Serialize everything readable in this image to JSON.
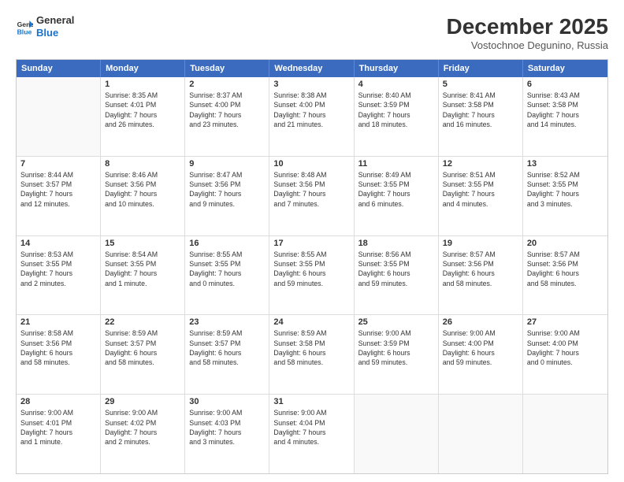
{
  "header": {
    "logo_line1": "General",
    "logo_line2": "Blue",
    "month_title": "December 2025",
    "location": "Vostochnoe Degunino, Russia"
  },
  "days_of_week": [
    "Sunday",
    "Monday",
    "Tuesday",
    "Wednesday",
    "Thursday",
    "Friday",
    "Saturday"
  ],
  "weeks": [
    [
      {
        "day": "",
        "info": ""
      },
      {
        "day": "1",
        "info": "Sunrise: 8:35 AM\nSunset: 4:01 PM\nDaylight: 7 hours\nand 26 minutes."
      },
      {
        "day": "2",
        "info": "Sunrise: 8:37 AM\nSunset: 4:00 PM\nDaylight: 7 hours\nand 23 minutes."
      },
      {
        "day": "3",
        "info": "Sunrise: 8:38 AM\nSunset: 4:00 PM\nDaylight: 7 hours\nand 21 minutes."
      },
      {
        "day": "4",
        "info": "Sunrise: 8:40 AM\nSunset: 3:59 PM\nDaylight: 7 hours\nand 18 minutes."
      },
      {
        "day": "5",
        "info": "Sunrise: 8:41 AM\nSunset: 3:58 PM\nDaylight: 7 hours\nand 16 minutes."
      },
      {
        "day": "6",
        "info": "Sunrise: 8:43 AM\nSunset: 3:58 PM\nDaylight: 7 hours\nand 14 minutes."
      }
    ],
    [
      {
        "day": "7",
        "info": "Sunrise: 8:44 AM\nSunset: 3:57 PM\nDaylight: 7 hours\nand 12 minutes."
      },
      {
        "day": "8",
        "info": "Sunrise: 8:46 AM\nSunset: 3:56 PM\nDaylight: 7 hours\nand 10 minutes."
      },
      {
        "day": "9",
        "info": "Sunrise: 8:47 AM\nSunset: 3:56 PM\nDaylight: 7 hours\nand 9 minutes."
      },
      {
        "day": "10",
        "info": "Sunrise: 8:48 AM\nSunset: 3:56 PM\nDaylight: 7 hours\nand 7 minutes."
      },
      {
        "day": "11",
        "info": "Sunrise: 8:49 AM\nSunset: 3:55 PM\nDaylight: 7 hours\nand 6 minutes."
      },
      {
        "day": "12",
        "info": "Sunrise: 8:51 AM\nSunset: 3:55 PM\nDaylight: 7 hours\nand 4 minutes."
      },
      {
        "day": "13",
        "info": "Sunrise: 8:52 AM\nSunset: 3:55 PM\nDaylight: 7 hours\nand 3 minutes."
      }
    ],
    [
      {
        "day": "14",
        "info": "Sunrise: 8:53 AM\nSunset: 3:55 PM\nDaylight: 7 hours\nand 2 minutes."
      },
      {
        "day": "15",
        "info": "Sunrise: 8:54 AM\nSunset: 3:55 PM\nDaylight: 7 hours\nand 1 minute."
      },
      {
        "day": "16",
        "info": "Sunrise: 8:55 AM\nSunset: 3:55 PM\nDaylight: 7 hours\nand 0 minutes."
      },
      {
        "day": "17",
        "info": "Sunrise: 8:55 AM\nSunset: 3:55 PM\nDaylight: 6 hours\nand 59 minutes."
      },
      {
        "day": "18",
        "info": "Sunrise: 8:56 AM\nSunset: 3:55 PM\nDaylight: 6 hours\nand 59 minutes."
      },
      {
        "day": "19",
        "info": "Sunrise: 8:57 AM\nSunset: 3:56 PM\nDaylight: 6 hours\nand 58 minutes."
      },
      {
        "day": "20",
        "info": "Sunrise: 8:57 AM\nSunset: 3:56 PM\nDaylight: 6 hours\nand 58 minutes."
      }
    ],
    [
      {
        "day": "21",
        "info": "Sunrise: 8:58 AM\nSunset: 3:56 PM\nDaylight: 6 hours\nand 58 minutes."
      },
      {
        "day": "22",
        "info": "Sunrise: 8:59 AM\nSunset: 3:57 PM\nDaylight: 6 hours\nand 58 minutes."
      },
      {
        "day": "23",
        "info": "Sunrise: 8:59 AM\nSunset: 3:57 PM\nDaylight: 6 hours\nand 58 minutes."
      },
      {
        "day": "24",
        "info": "Sunrise: 8:59 AM\nSunset: 3:58 PM\nDaylight: 6 hours\nand 58 minutes."
      },
      {
        "day": "25",
        "info": "Sunrise: 9:00 AM\nSunset: 3:59 PM\nDaylight: 6 hours\nand 59 minutes."
      },
      {
        "day": "26",
        "info": "Sunrise: 9:00 AM\nSunset: 4:00 PM\nDaylight: 6 hours\nand 59 minutes."
      },
      {
        "day": "27",
        "info": "Sunrise: 9:00 AM\nSunset: 4:00 PM\nDaylight: 7 hours\nand 0 minutes."
      }
    ],
    [
      {
        "day": "28",
        "info": "Sunrise: 9:00 AM\nSunset: 4:01 PM\nDaylight: 7 hours\nand 1 minute."
      },
      {
        "day": "29",
        "info": "Sunrise: 9:00 AM\nSunset: 4:02 PM\nDaylight: 7 hours\nand 2 minutes."
      },
      {
        "day": "30",
        "info": "Sunrise: 9:00 AM\nSunset: 4:03 PM\nDaylight: 7 hours\nand 3 minutes."
      },
      {
        "day": "31",
        "info": "Sunrise: 9:00 AM\nSunset: 4:04 PM\nDaylight: 7 hours\nand 4 minutes."
      },
      {
        "day": "",
        "info": ""
      },
      {
        "day": "",
        "info": ""
      },
      {
        "day": "",
        "info": ""
      }
    ]
  ]
}
